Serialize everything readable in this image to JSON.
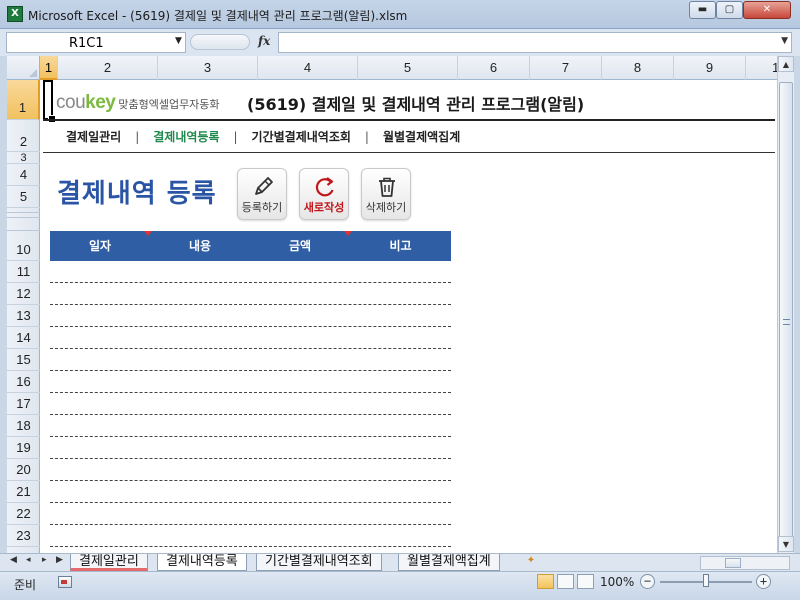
{
  "window": {
    "app_icon": "X",
    "title": "Microsoft Excel - (5619) 결제일 및 결제내역 관리 프로그램(알림).xlsm",
    "min_glyph": "▬",
    "max_glyph": "▢",
    "close_glyph": "✕"
  },
  "formula_bar": {
    "name_box": "R1C1",
    "dropdown_glyph": "▼",
    "fx": "fx",
    "formula": "",
    "expand_glyph": "▼"
  },
  "columns": [
    "1",
    "2",
    "3",
    "4",
    "5",
    "6",
    "7",
    "8",
    "9",
    "1"
  ],
  "rows": [
    "1",
    "2",
    "3",
    "4",
    "5",
    "10",
    "11",
    "12",
    "13",
    "14",
    "15",
    "16",
    "17",
    "18",
    "19",
    "20",
    "21",
    "22",
    "23"
  ],
  "sheet": {
    "logo_prefix": "cou",
    "logo_suffix": "key",
    "logo_tagline": "맞춤형엑셀업무자동화",
    "doc_title": "(5619) 결제일 및 결제내역 관리 프로그램(알림)",
    "nav": {
      "item1": "결제일관리",
      "item2": "결제내역등록",
      "item3": "기간별결제내역조회",
      "item4": "월별결제액집계",
      "sep": "|"
    },
    "section_title": "결제내역 등록",
    "buttons": {
      "register": "등록하기",
      "new": "새로작성",
      "delete": "삭제하기"
    },
    "table_headers": [
      "일자",
      "내용",
      "금액",
      "비고"
    ],
    "empty_row_count": 13
  },
  "tabs": {
    "nav_first": "◀",
    "nav_prev": "◂",
    "nav_next": "▸",
    "nav_last": "▶",
    "sheets": [
      "결제일관리",
      "결제내역등록",
      "기간별결제내역조회",
      "월별결제액집계"
    ],
    "active_index": 1
  },
  "status": {
    "ready": "준비",
    "zoom": "100%",
    "zoom_level_percent": 100,
    "zoom_minus": "−",
    "zoom_plus": "+"
  },
  "colors": {
    "accent_blue": "#2f5ea5",
    "nav_active": "#1f8a4c",
    "new_button_red": "#c0161b"
  }
}
